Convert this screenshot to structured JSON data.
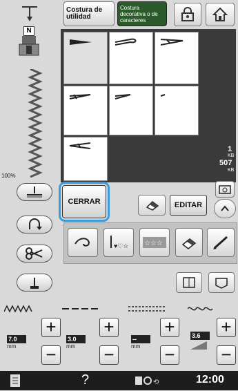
{
  "tabs": {
    "utility": "Costura de utilidad",
    "decorative": "Costura decorativa o de caracteres"
  },
  "presser_foot_code": "N",
  "zoom_level": "100%",
  "side_info": {
    "line1": "1",
    "line2": "KB",
    "line3": "507",
    "line4": "KB"
  },
  "buttons": {
    "cerrar": "CERRAR",
    "editar": "EDITAR"
  },
  "sliders": [
    {
      "value": "7.0",
      "unit": "mm"
    },
    {
      "value": "3.0",
      "unit": "mm"
    },
    {
      "value": "--",
      "unit": "mm"
    },
    {
      "value": "3.6",
      "unit": ""
    }
  ],
  "bottom": {
    "time": "12:00",
    "help": "?"
  },
  "colors": {
    "highlight": "#3a9be0",
    "background": "#d9d9d9",
    "dark_panel": "#3a3a3a"
  }
}
